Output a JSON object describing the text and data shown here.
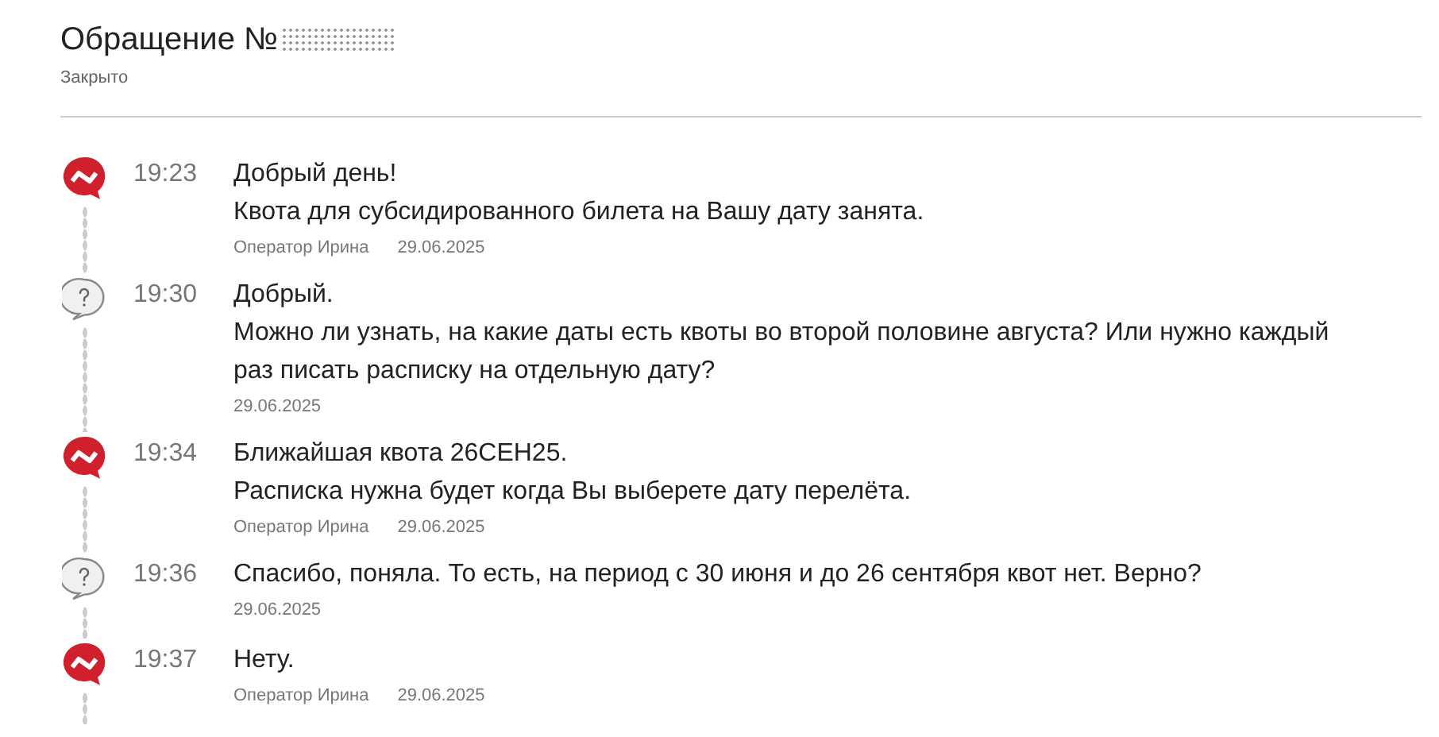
{
  "header": {
    "title": "Обращение №",
    "status": "Закрыто"
  },
  "messages": [
    {
      "kind": "operator",
      "time": "19:23",
      "lines": [
        "Добрый день!",
        "Квота для субсидированного билета на Вашу дату занята."
      ],
      "author": "Оператор Ирина",
      "date": "29.06.2025"
    },
    {
      "kind": "user",
      "time": "19:30",
      "lines": [
        "Добрый.",
        "Можно ли узнать, на какие даты есть квоты во второй половине августа? Или нужно каждый раз писать расписку на отдельную дату?"
      ],
      "date": "29.06.2025"
    },
    {
      "kind": "operator",
      "time": "19:34",
      "lines": [
        "Ближайшая квота 26СЕН25.",
        "Расписка нужна будет когда Вы выберете дату перелёта."
      ],
      "author": "Оператор Ирина",
      "date": "29.06.2025"
    },
    {
      "kind": "user",
      "time": "19:36",
      "lines": [
        "Спасибо, поняла. То есть, на период с 30 июня и до 26 сентября квот нет. Верно?"
      ],
      "date": "29.06.2025"
    },
    {
      "kind": "operator",
      "time": "19:37",
      "lines": [
        "Нету."
      ],
      "author": "Оператор Ирина",
      "date": "29.06.2025"
    }
  ]
}
